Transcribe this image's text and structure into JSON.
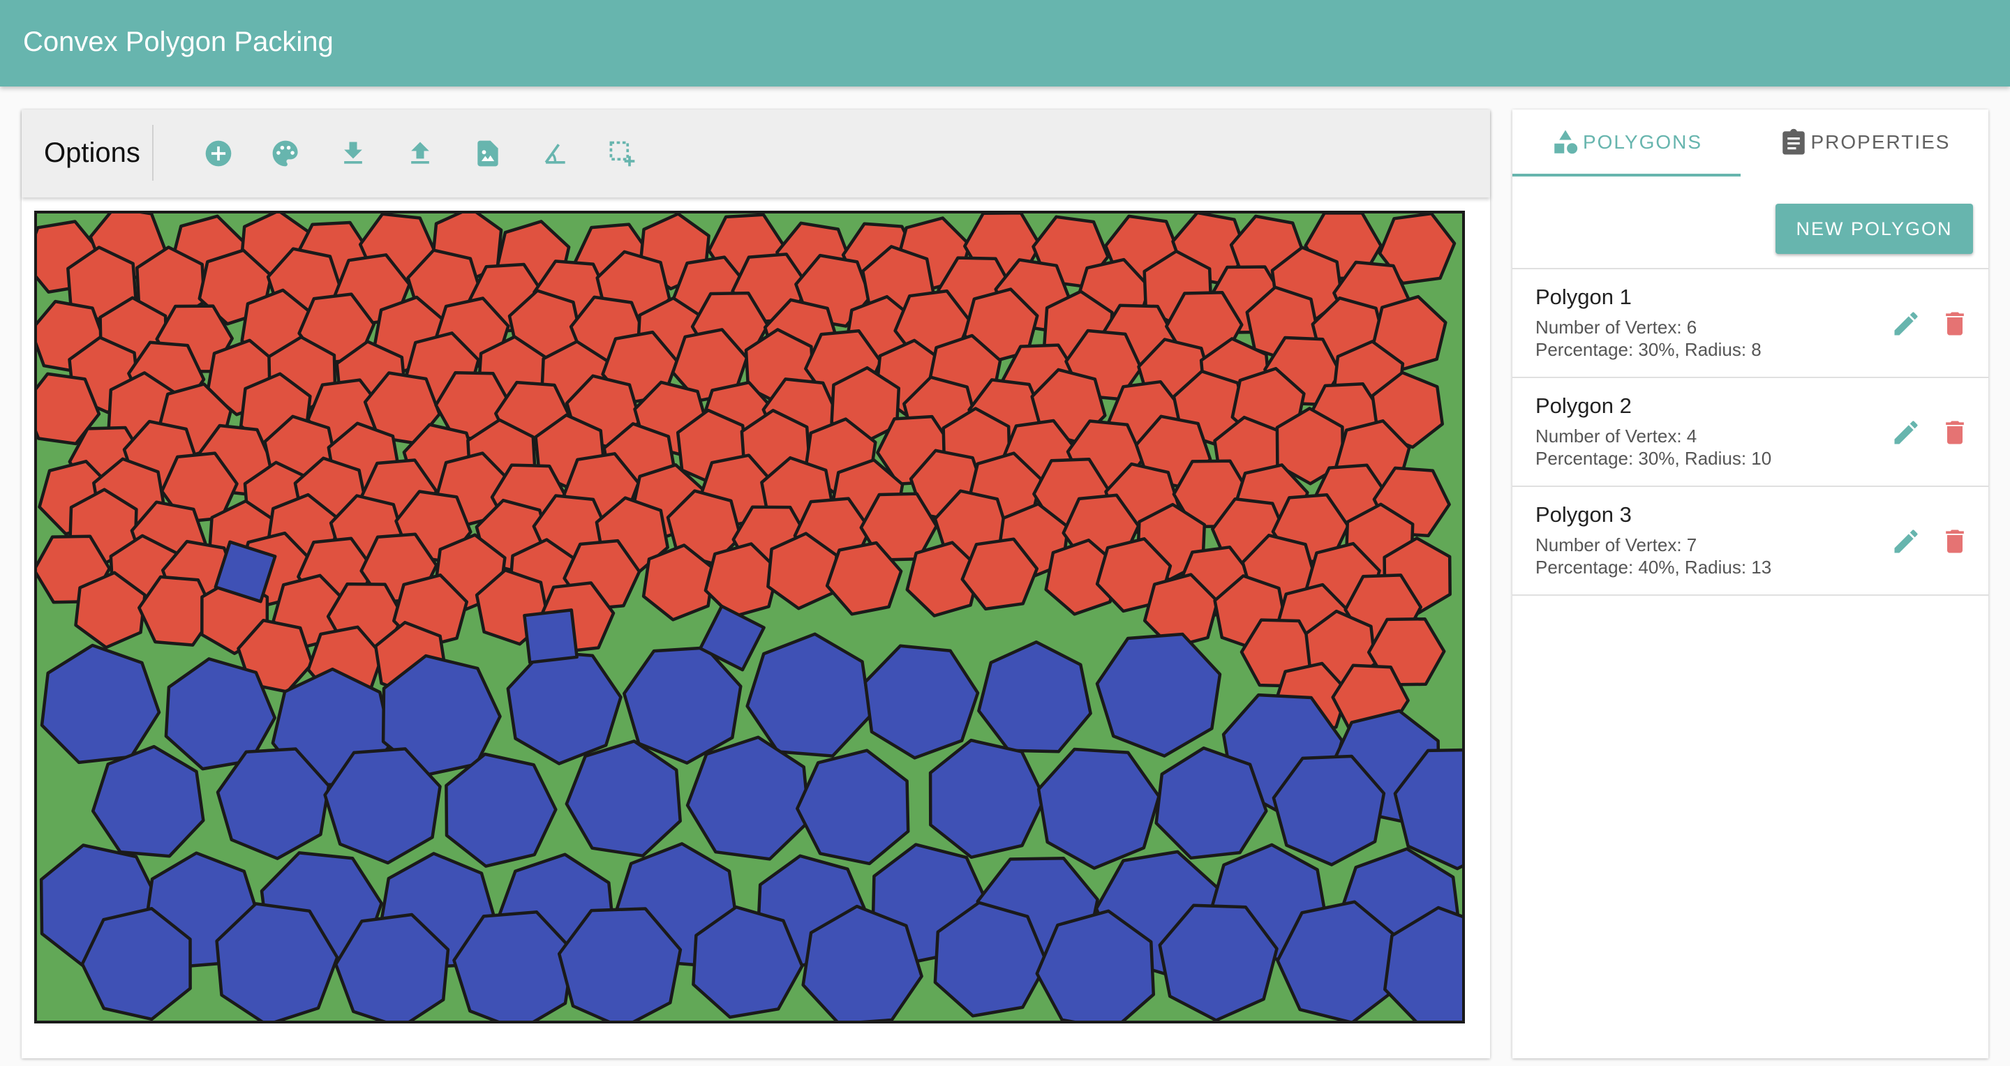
{
  "app": {
    "title": "Convex Polygon Packing",
    "accent_color": "#67b5ae"
  },
  "toolbar": {
    "options_label": "Options",
    "tools": [
      {
        "icon": "add-circle-icon",
        "name": "add"
      },
      {
        "icon": "palette-icon",
        "name": "palette"
      },
      {
        "icon": "download-icon",
        "name": "download"
      },
      {
        "icon": "upload-icon",
        "name": "upload"
      },
      {
        "icon": "image-file-icon",
        "name": "image"
      },
      {
        "icon": "angle-icon",
        "name": "angle"
      },
      {
        "icon": "select-add-icon",
        "name": "select"
      }
    ]
  },
  "canvas": {
    "background_color": "#62a857",
    "border_color": "#1a1a1a",
    "colors": {
      "hexagon": "#e05240",
      "heptagon": "#3f51b5",
      "square": "#3f51b5"
    }
  },
  "tabs": [
    {
      "label": "POLYGONS",
      "icon": "shapes-icon",
      "active": true
    },
    {
      "label": "PROPERTIES",
      "icon": "clipboard-icon",
      "active": false
    }
  ],
  "new_polygon_label": "NEW POLYGON",
  "polygons": [
    {
      "name": "Polygon 1",
      "vertex_text": "Number of Vertex: 6",
      "detail_text": "Percentage: 30%, Radius: 8"
    },
    {
      "name": "Polygon 2",
      "vertex_text": "Number of Vertex: 4",
      "detail_text": "Percentage: 30%, Radius: 10"
    },
    {
      "name": "Polygon 3",
      "vertex_text": "Number of Vertex: 7",
      "detail_text": "Percentage: 40%, Radius: 13"
    }
  ],
  "action_colors": {
    "edit": "#67b5ae",
    "delete": "#e57373"
  }
}
